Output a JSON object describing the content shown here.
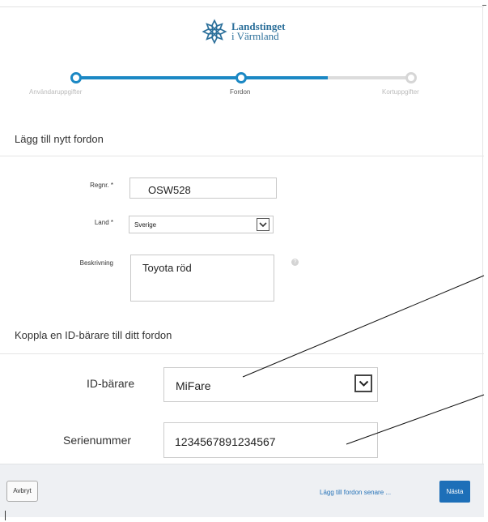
{
  "header": {
    "logo_line1": "Landstinget",
    "logo_line2": "i Värmland",
    "logo_icon": "snowflake-flower-icon",
    "brand_color": "#2b6f9a"
  },
  "stepper": {
    "steps": [
      {
        "label": "Användaruppgifter",
        "state": "completed"
      },
      {
        "label": "Fordon",
        "state": "active"
      },
      {
        "label": "Kortuppgifter",
        "state": "inactive"
      }
    ],
    "active_color": "#1b88c4",
    "inactive_color": "#dcdcdc"
  },
  "vehicle_section": {
    "title": "Lägg till nytt fordon",
    "regnr_label": "Regnr. *",
    "regnr_value": "OSW528",
    "land_label": "Land *",
    "land_value": "Sverige",
    "beskrivning_label": "Beskrivning",
    "beskrivning_value": "Toyota röd",
    "help_icon": "question-circle-icon"
  },
  "id_section": {
    "title": "Koppla en ID-bärare till ditt fordon",
    "id_label": "ID-bärare",
    "id_value": "MiFare",
    "serie_label": "Serienummer",
    "serie_value": "1234567891234567"
  },
  "footer": {
    "cancel_label": "Avbryt",
    "later_label": "Lägg till fordon senare ...",
    "next_label": "Nästa",
    "next_color": "#1d6fb8",
    "link_color": "#2673b8"
  }
}
